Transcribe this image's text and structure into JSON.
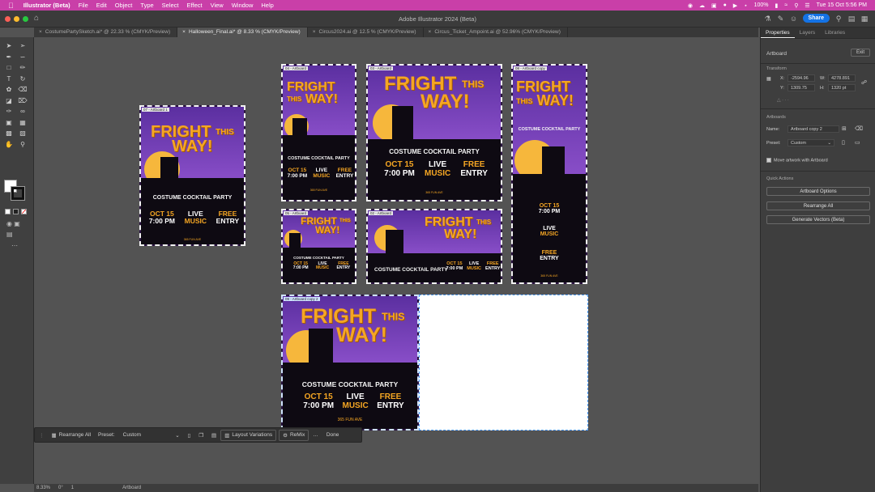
{
  "menubar": {
    "app_name": "Illustrator (Beta)",
    "items": [
      "File",
      "Edit",
      "Object",
      "Type",
      "Select",
      "Effect",
      "View",
      "Window",
      "Help"
    ],
    "battery": "100%",
    "clock": "Tue 15 Oct 5:56 PM"
  },
  "window": {
    "title": "Adobe Illustrator 2024 (Beta)",
    "share_label": "Share"
  },
  "doc_tabs": [
    "CostumePartySketch.ai* @ 22.33 % (CMYK/Preview)",
    "Halloween_Final.ai* @ 8.33 % (CMYK/Preview)",
    "Circus2024.ai @ 12.5 % (CMYK/Preview)",
    "Circus_Ticket_Ampoint.ai @ 52.96% (CMYK/Preview)"
  ],
  "poster": {
    "fright": "FRIGHT",
    "this": "THIS",
    "way": "WAY!",
    "costume": "COSTUME COCKTAIL PARTY",
    "date": "OCT 15",
    "time": "7:00 PM",
    "live": "LIVE",
    "music": "MUSIC",
    "free": "FREE",
    "entry": "ENTRY",
    "address": "365 FUN AVE"
  },
  "artboards": {
    "ab7": "07 - Artboard 1",
    "ab4": "04 - Artboard",
    "ab3": "03 - Artboard",
    "ab8": "08 - Artboard copy",
    "ab5": "05 - Artboard",
    "ab2": "02 - Artboard",
    "ab9": "09 - Artboard copy 2"
  },
  "context_bar": {
    "rearrange_all": "Rearrange All",
    "preset_label": "Preset:",
    "preset_value": "Custom",
    "layout_variations": "Layout Variations",
    "remix": "ReMix",
    "more": "…",
    "done": "Done"
  },
  "status_bar": {
    "zoom": "8.33%",
    "rotation": "0°",
    "page": "1",
    "mode": "Artboard"
  },
  "properties": {
    "tabs": [
      "Properties",
      "Layers",
      "Libraries"
    ],
    "section_artboard": "Artboard",
    "exit_label": "Exit",
    "transform_label": "Transform",
    "x_label": "X:",
    "x_value": "-2594.96",
    "y_label": "Y:",
    "y_value": "1309.75",
    "w_label": "W:",
    "w_value": "4278.891",
    "h_label": "H:",
    "h_value": "1320 pt",
    "artboards_label": "Artboards",
    "name_label": "Name:",
    "name_value": "Artboard copy 2",
    "preset_label": "Preset:",
    "preset_value": "Custom",
    "move_artwork": "Move artwork with Artboard",
    "quick_actions": "Quick Actions",
    "btn_artboard_options": "Artboard Options",
    "btn_rearrange_all": "Rearrange All",
    "btn_generate_vectors": "Generate Vectors (Beta)"
  },
  "colors": {
    "menubar": "#c93fa8",
    "accent": "#1473e6",
    "poster_orange": "#f5a623",
    "poster_purple": "#5b2fa0"
  }
}
